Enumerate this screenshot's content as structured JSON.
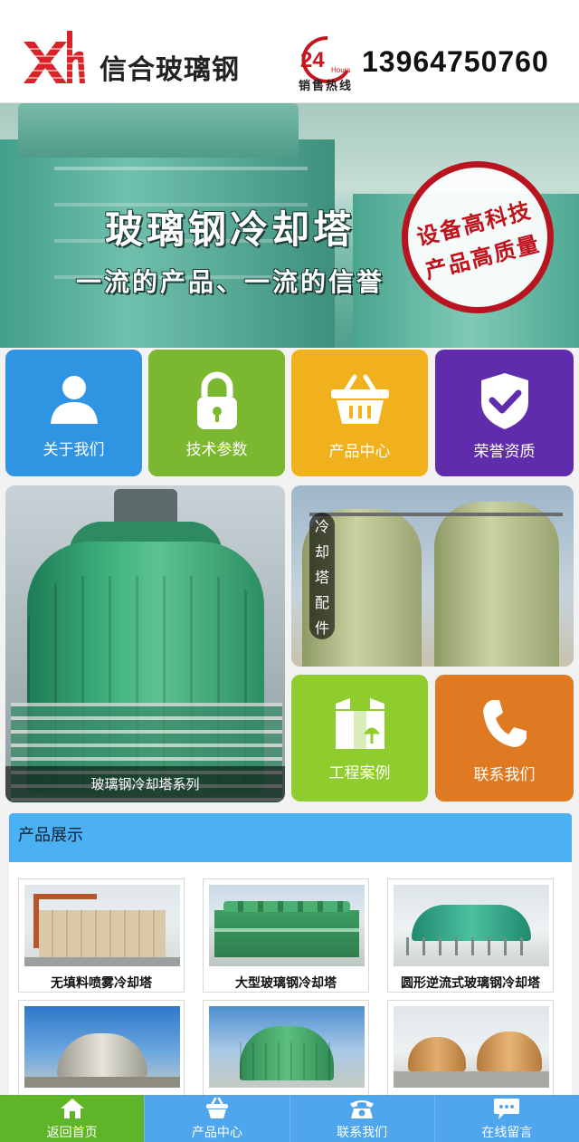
{
  "header": {
    "brand": "信合玻璃钢",
    "hotline_badge": "24",
    "hotline_badge_sub": "Hours",
    "hotline_caption": "销售热线",
    "phone": "13964750760",
    "colors": {
      "logo": "#d8232a",
      "badge": "#c4161c"
    }
  },
  "banner": {
    "title": "玻璃钢冷却塔",
    "subtitle": "一流的产品、一流的信誉",
    "stamp_line1": "设备高科技",
    "stamp_line2": "产品高质量"
  },
  "tiles": [
    {
      "label": "关于我们",
      "icon": "user-icon",
      "color": "#2f95e3"
    },
    {
      "label": "技术参数",
      "icon": "lock-icon",
      "color": "#7cb82f"
    },
    {
      "label": "产品中心",
      "icon": "basket-icon",
      "color": "#f0b11c"
    },
    {
      "label": "荣誉资质",
      "icon": "shield-check-icon",
      "color": "#5f2dab"
    },
    {
      "label": "工程案例",
      "icon": "box-icon",
      "color": "#8fcd2e"
    },
    {
      "label": "联系我们",
      "icon": "phone-icon",
      "color": "#e07a22"
    }
  ],
  "feature": {
    "big_caption": "玻璃钢冷却塔系列",
    "tanks_chars": [
      "冷",
      "却",
      "塔",
      "配",
      "件"
    ]
  },
  "products": {
    "heading": "产品展示",
    "items": [
      {
        "caption": "无填料喷雾冷却塔"
      },
      {
        "caption": "大型玻璃钢冷却塔"
      },
      {
        "caption": "圆形逆流式玻璃钢冷却塔"
      },
      {
        "caption": ""
      },
      {
        "caption": ""
      },
      {
        "caption": ""
      }
    ]
  },
  "bottom_nav": [
    {
      "label": "返回首页",
      "icon": "home-icon"
    },
    {
      "label": "产品中心",
      "icon": "basket-icon"
    },
    {
      "label": "联系我们",
      "icon": "telephone-icon"
    },
    {
      "label": "在线留言",
      "icon": "chat-icon"
    }
  ]
}
